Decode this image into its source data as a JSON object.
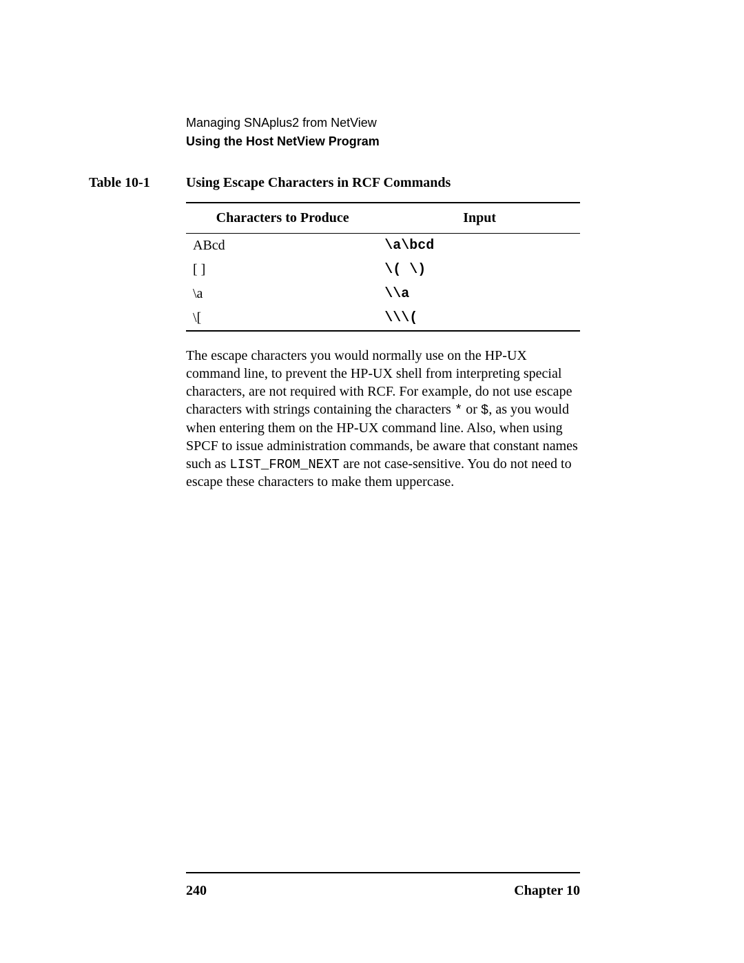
{
  "header": {
    "line1": "Managing SNAplus2 from NetView",
    "line2": "Using the Host NetView Program"
  },
  "table": {
    "label": "Table 10-1",
    "caption": "Using Escape Characters in RCF Commands",
    "headers": {
      "col1": "Characters to Produce",
      "col2": "Input"
    },
    "rows": [
      {
        "produce": "ABcd",
        "input": "\\a\\bcd"
      },
      {
        "produce": "[ ]",
        "input": "\\( \\)"
      },
      {
        "produce": "\\a",
        "input": "\\\\a"
      },
      {
        "produce": "\\[",
        "input": "\\\\\\("
      }
    ]
  },
  "paragraph": {
    "part1": "The escape characters you would normally use on the HP-UX command line, to prevent the HP-UX shell from interpreting special characters, are not required with RCF. For example, do not use escape characters with strings containing the characters ",
    "star": "*",
    "or": " or ",
    "dollar": "$",
    "part2": ", as you would when entering them on the HP-UX command line. Also, when using SPCF to issue administration commands, be aware that constant names such as ",
    "const": "LIST_FROM_NEXT",
    "part3": " are not case-sensitive. You do not need to escape these characters to make them uppercase."
  },
  "footer": {
    "page": "240",
    "chapter": "Chapter 10"
  }
}
